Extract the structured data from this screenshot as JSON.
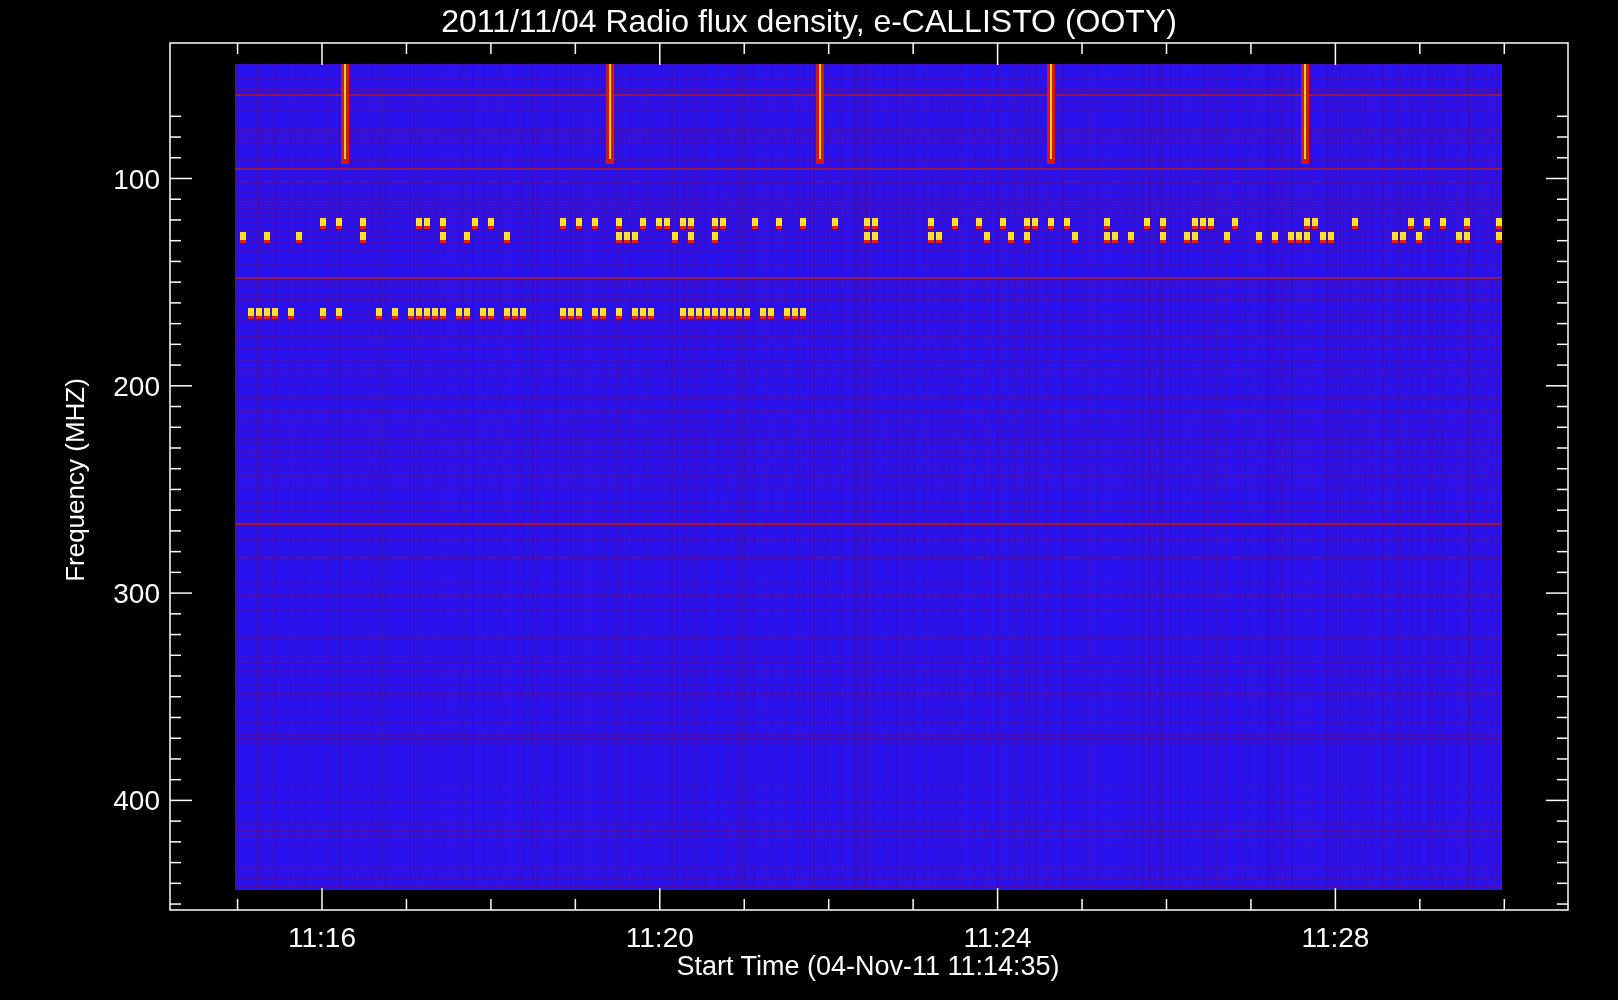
{
  "title": "2011/11/04  Radio flux density, e-CALLISTO (OOTY)",
  "y_axis": {
    "label": "Frequency (MHZ)",
    "ticks": [
      "100",
      "200",
      "300",
      "400"
    ]
  },
  "x_axis": {
    "label": "Start Time (04-Nov-11 11:14:35)",
    "ticks": [
      "11:16",
      "11:20",
      "11:24",
      "11:28"
    ]
  }
}
